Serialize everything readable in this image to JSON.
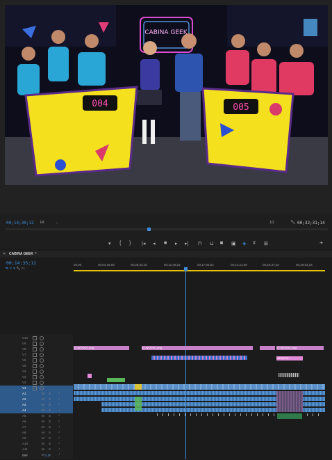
{
  "program_monitor": {
    "timecode_current": "00;14;30;12",
    "fit_label": "Fit",
    "resolution_label": "1/2",
    "timecode_duration": "00;32;31;14",
    "scene_sign": "CABINA GEEK",
    "podium_left_number": "004",
    "podium_right_number": "005"
  },
  "timeline": {
    "sequence_name": "CABINA GEEK",
    "timecode": "00;14;35;12",
    "ruler_ticks": [
      "00;00",
      "00;04;16;08",
      "00;08;32;16",
      "00;12;48;22",
      "00;17;05;02",
      "00;21;21;08",
      "00;25;37;16",
      "00;29;53;24"
    ],
    "video_tracks": [
      "V10",
      "V9",
      "V8",
      "V7",
      "V6",
      "V5",
      "V4",
      "V3",
      "V2",
      "V1"
    ],
    "audio_tracks": [
      "A1",
      "A2",
      "A3",
      "A4",
      "A5",
      "A6",
      "A7",
      "A8",
      "A9",
      "A10",
      "A11",
      "A12"
    ],
    "mix_label": "Mix",
    "mix_value": "0.0",
    "clip_labels": {
      "v7_clip1": "02-WODSC.png",
      "v7_clip2": "02-WODSC.png",
      "v7_clip3": "02-WODSC.png",
      "v5_clip": "NEGATIV..."
    }
  },
  "colors": {
    "accent_blue": "#3d8ee0",
    "playhead": "#3d8ee0",
    "work_area": "#e6c200"
  }
}
